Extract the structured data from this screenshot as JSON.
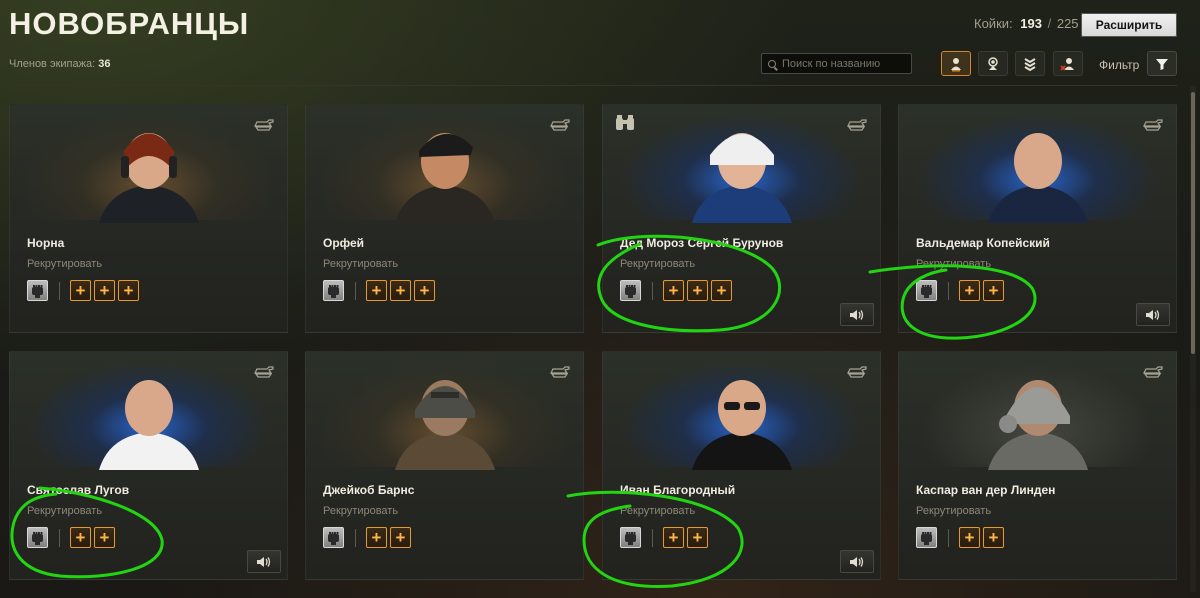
{
  "header": {
    "title": "НОВОБРАНЦЫ",
    "crew_label": "Членов экипажа:",
    "crew_count": "36",
    "berths_label": "Койки:",
    "berths_current": "193",
    "berths_separator": "/",
    "berths_total": "225",
    "expand_label": "Расширить"
  },
  "toolbar": {
    "search_placeholder": "Поиск по названию",
    "filter_label": "Фильтр",
    "type_filters": [
      {
        "icon": "crew-member-icon",
        "active": true
      },
      {
        "icon": "crew-portrait-icon",
        "active": false
      },
      {
        "icon": "rank-chevrons-icon",
        "active": false
      },
      {
        "icon": "dismissed-crew-icon",
        "active": false
      }
    ]
  },
  "cards": [
    {
      "name": "Норна",
      "action": "Рекрутировать",
      "pluses": 3,
      "voice": false,
      "binoculars": false,
      "glow": "warm"
    },
    {
      "name": "Орфей",
      "action": "Рекрутировать",
      "pluses": 3,
      "voice": false,
      "binoculars": false,
      "glow": "warm"
    },
    {
      "name": "Дед Мороз Сергей Бурунов",
      "action": "Рекрутировать",
      "pluses": 3,
      "voice": true,
      "binoculars": true,
      "glow": "blue"
    },
    {
      "name": "Вальдемар Копейский",
      "action": "Рекрутировать",
      "pluses": 2,
      "voice": true,
      "binoculars": false,
      "glow": "blue"
    },
    {
      "name": "Святослав Лугов",
      "action": "Рекрутировать",
      "pluses": 2,
      "voice": true,
      "binoculars": false,
      "glow": "blue"
    },
    {
      "name": "Джейкоб Барнс",
      "action": "Рекрутировать",
      "pluses": 2,
      "voice": false,
      "binoculars": false,
      "glow": "warm"
    },
    {
      "name": "Иван Благородный",
      "action": "Рекрутировать",
      "pluses": 2,
      "voice": true,
      "binoculars": false,
      "glow": "blue"
    },
    {
      "name": "Каспар ван дер Линден",
      "action": "Рекрутировать",
      "pluses": 2,
      "voice": false,
      "binoculars": false,
      "glow": "neutral"
    }
  ],
  "colors": {
    "accent_orange": "#e59a2f",
    "annotation_green": "#22d412",
    "blue_glow": "#2a6fe0"
  }
}
